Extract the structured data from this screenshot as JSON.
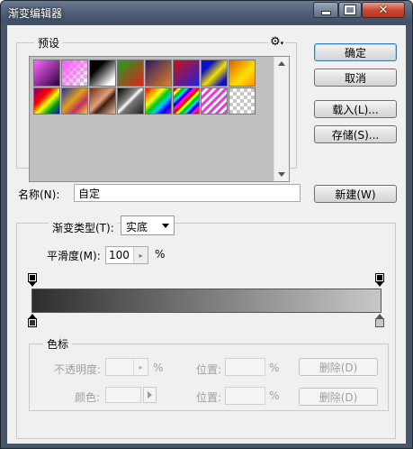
{
  "window": {
    "title": "渐变编辑器"
  },
  "presets": {
    "label": "预设"
  },
  "buttons": {
    "ok": "确定",
    "cancel": "取消",
    "load": "载入(L)...",
    "save": "存储(S)...",
    "new": "新建(W)"
  },
  "name": {
    "label": "名称(N):",
    "value": "自定"
  },
  "gradient": {
    "type_label": "渐变类型(T):",
    "type_value": "实底",
    "smooth_label": "平滑度(M):",
    "smooth_value": "100",
    "smooth_unit": "%",
    "start_color": "#2e2e2e",
    "end_color": "#c8c8c8"
  },
  "color_stop": {
    "group_label": "色标",
    "opacity_label": "不透明度:",
    "opacity_unit": "%",
    "location_label": "位置:",
    "location_unit": "%",
    "delete_label": "删除(D)",
    "color_label": "颜色:"
  }
}
